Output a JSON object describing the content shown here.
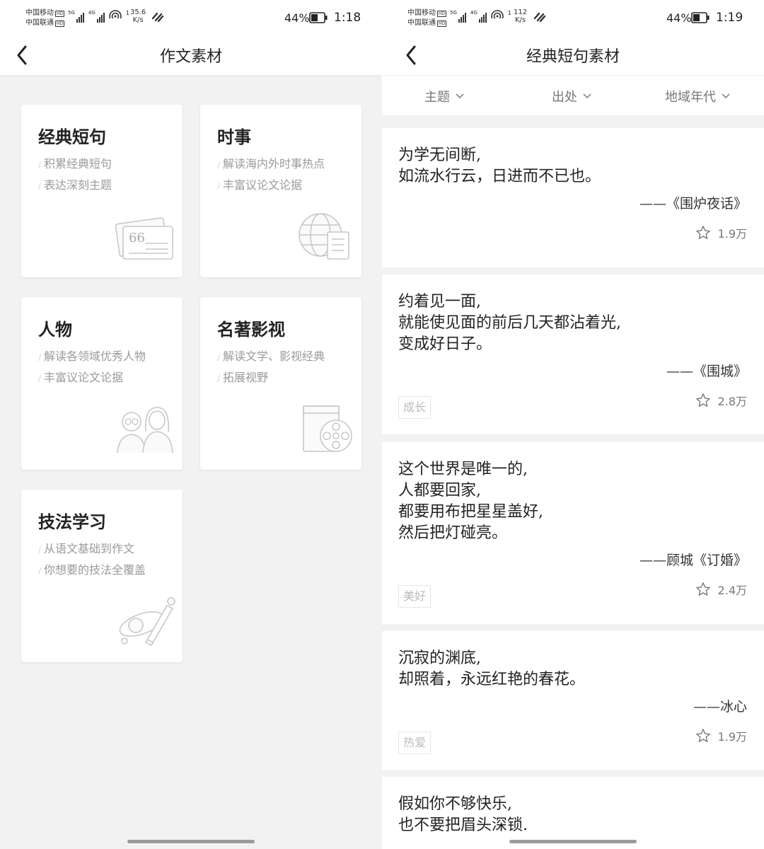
{
  "left": {
    "status": {
      "carrier1": "中国移动",
      "carrier2": "中国联通",
      "net1": "5G",
      "net2": "4G",
      "wifi_num": "1",
      "speed_value": "35.6",
      "speed_unit": "K/s",
      "battery": "44%",
      "time": "1:18"
    },
    "header": {
      "title": "作文素材"
    },
    "cards": [
      {
        "title": "经典短句",
        "lines": [
          "积累经典短句",
          "表达深刻主题"
        ],
        "icon": "quote-card-icon"
      },
      {
        "title": "时事",
        "lines": [
          "解读海内外时事热点",
          "丰富议论文论据"
        ],
        "icon": "globe-news-icon"
      },
      {
        "title": "人物",
        "lines": [
          "解读各领域优秀人物",
          "丰富议论文论据"
        ],
        "icon": "people-icon"
      },
      {
        "title": "名著影视",
        "lines": [
          "解读文学、影视经典",
          "拓展视野"
        ],
        "icon": "book-film-icon"
      },
      {
        "title": "技法学习",
        "lines": [
          "从语文基础到作文",
          "你想要的技法全覆盖"
        ],
        "icon": "pencil-orbit-icon"
      }
    ]
  },
  "right": {
    "status": {
      "carrier1": "中国移动",
      "carrier2": "中国联通",
      "net1": "5G",
      "net2": "4G",
      "wifi_num": "1",
      "speed_value": "112",
      "speed_unit": "K/s",
      "battery": "44%",
      "time": "1:19"
    },
    "header": {
      "title": "经典短句素材"
    },
    "filters": [
      "主题",
      "出处",
      "地域年代"
    ],
    "quotes": [
      {
        "lines": [
          "为学无间断,",
          "如流水行云，日进而不已也。"
        ],
        "source": "——《围炉夜话》",
        "tag": "",
        "favorites": "1.9万"
      },
      {
        "lines": [
          "约着见一面,",
          "就能使见面的前后几天都沾着光,",
          "变成好日子。"
        ],
        "source": "——《围城》",
        "tag": "成长",
        "favorites": "2.8万"
      },
      {
        "lines": [
          "这个世界是唯一的,",
          "人都要回家,",
          "都要用布把星星盖好,",
          "然后把灯碰亮。"
        ],
        "source": "——顾城《订婚》",
        "tag": "美好",
        "favorites": "2.4万"
      },
      {
        "lines": [
          "沉寂的渊底,",
          "却照着，永远红艳的春花。"
        ],
        "source": "——冰心",
        "tag": "热爱",
        "favorites": "1.9万"
      },
      {
        "lines": [
          "假如你不够快乐,",
          "也不要把眉头深锁."
        ],
        "source": "",
        "tag": "",
        "favorites": ""
      }
    ]
  },
  "colors": {
    "bg": "#f2f2f2",
    "card": "#ffffff",
    "muted": "#9a9a9a",
    "text": "#222222"
  }
}
